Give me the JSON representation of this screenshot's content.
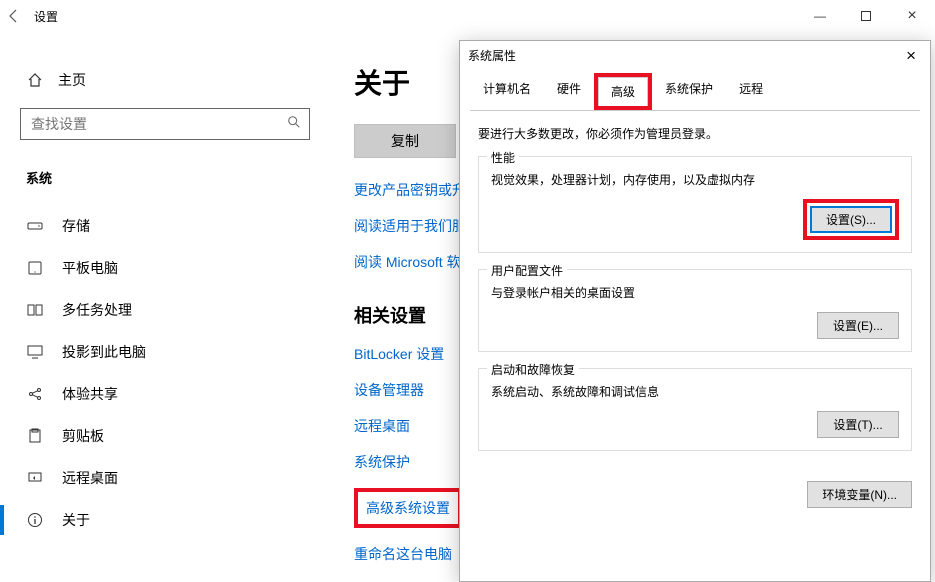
{
  "window": {
    "title": "设置",
    "minimize": "—",
    "close": "×"
  },
  "sidebar": {
    "home": "主页",
    "search_placeholder": "查找设置",
    "category": "系统",
    "items": [
      {
        "label": "存储"
      },
      {
        "label": "平板电脑"
      },
      {
        "label": "多任务处理"
      },
      {
        "label": "投影到此电脑"
      },
      {
        "label": "体验共享"
      },
      {
        "label": "剪贴板"
      },
      {
        "label": "远程桌面"
      },
      {
        "label": "关于"
      }
    ]
  },
  "main": {
    "title": "关于",
    "copy_btn": "复制",
    "links": [
      "更改产品密钥或升",
      "阅读适用于我们服",
      "阅读 Microsoft 软"
    ],
    "related_hdr": "相关设置",
    "related": [
      "BitLocker 设置",
      "设备管理器",
      "远程桌面",
      "系统保护",
      "高级系统设置",
      "重命名这台电脑"
    ]
  },
  "sysprops": {
    "title": "系统属性",
    "tabs": [
      "计算机名",
      "硬件",
      "高级",
      "系统保护",
      "远程"
    ],
    "note": "要进行大多数更改，你必须作为管理员登录。",
    "perf": {
      "title": "性能",
      "desc": "视觉效果，处理器计划，内存使用，以及虚拟内存",
      "btn": "设置(S)..."
    },
    "profile": {
      "title": "用户配置文件",
      "desc": "与登录帐户相关的桌面设置",
      "btn": "设置(E)..."
    },
    "startup": {
      "title": "启动和故障恢复",
      "desc": "系统启动、系统故障和调试信息",
      "btn": "设置(T)..."
    },
    "env_btn": "环境变量(N)..."
  }
}
